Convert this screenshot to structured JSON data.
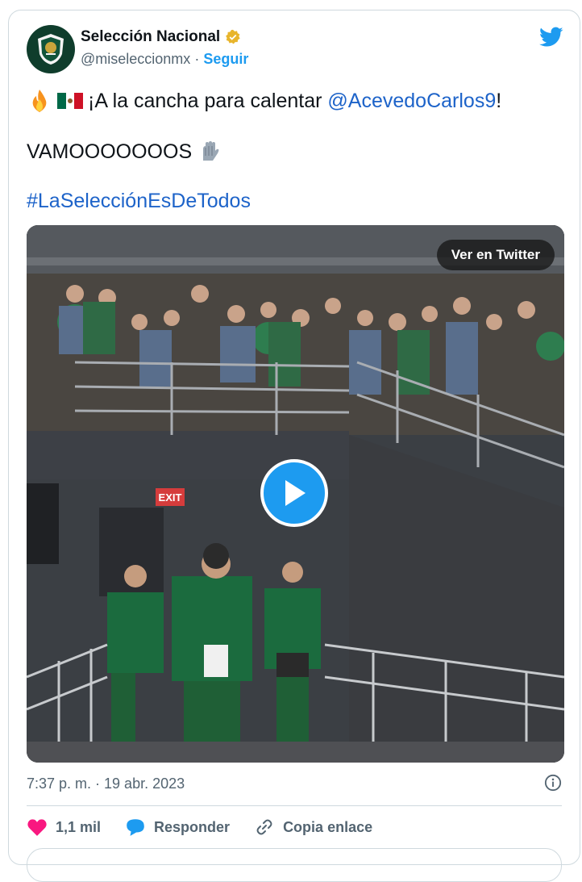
{
  "tweet": {
    "display_name": "Selección Nacional",
    "handle": "@miseleccionmx",
    "separator": "·",
    "follow_label": "Seguir",
    "text_line1_prefix": "¡A la cancha para calentar ",
    "mention": "@AcevedoCarlos9",
    "text_line1_suffix": "!",
    "text_line2": "VAMOOOOOOOS",
    "hashtag": "#LaSelecciónEsDeTodos",
    "timestamp": "7:37 p. m. · 19 abr. 2023"
  },
  "media": {
    "view_on_twitter_label": "Ver en Twitter",
    "exit_sign": "EXIT"
  },
  "actions": {
    "like_count": "1,1 mil",
    "reply_label": "Responder",
    "copy_link_label": "Copia enlace"
  },
  "colors": {
    "accent": "#1d9bf0",
    "link": "#1d63c9",
    "like": "#f91880",
    "muted": "#536471"
  },
  "icons": [
    "twitter-bird-icon",
    "verified-badge-icon",
    "fire-emoji-icon",
    "mexico-flag-icon",
    "gloves-emoji-icon",
    "play-icon",
    "info-icon",
    "heart-icon",
    "reply-icon",
    "link-icon"
  ]
}
